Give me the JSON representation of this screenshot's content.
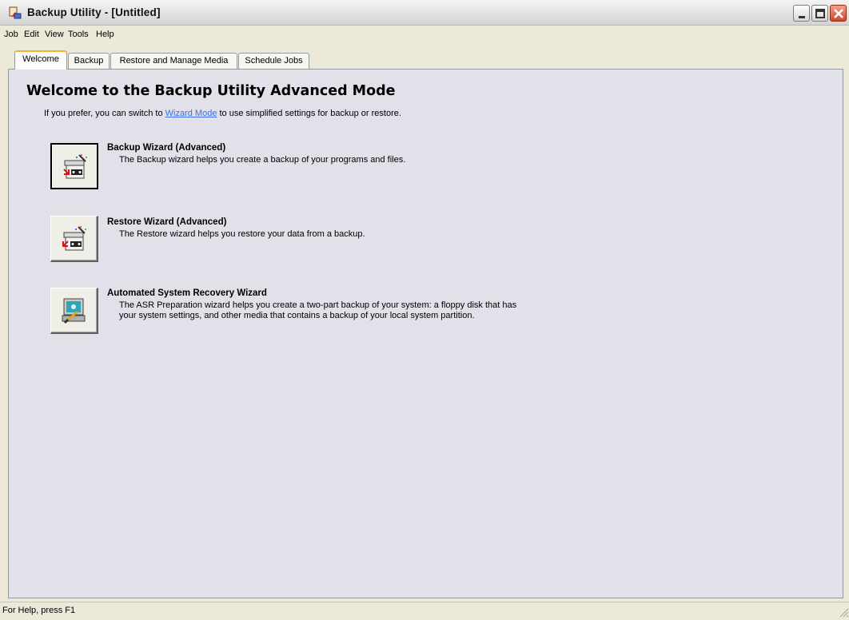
{
  "window": {
    "title": "Backup Utility - [Untitled]"
  },
  "menu": [
    "Job",
    "Edit",
    "View",
    "Tools",
    "Help"
  ],
  "tabs": [
    {
      "label": "Welcome",
      "active": true
    },
    {
      "label": "Backup",
      "active": false
    },
    {
      "label": "Restore and Manage Media",
      "active": false
    },
    {
      "label": "Schedule Jobs",
      "active": false
    }
  ],
  "welcome": {
    "heading": "Welcome to the Backup Utility Advanced Mode",
    "intro_before": "If you prefer, you can switch to ",
    "intro_link": "Wizard Mode",
    "intro_after": " to use simplified settings for backup or restore."
  },
  "wizards": [
    {
      "title": "Backup Wizard (Advanced)",
      "description": "The Backup wizard helps you create a backup of your programs and files.",
      "icon": "backup-wizard-icon"
    },
    {
      "title": "Restore Wizard (Advanced)",
      "description": "The Restore wizard helps you restore your data from a backup.",
      "icon": "restore-wizard-icon"
    },
    {
      "title": "Automated System Recovery Wizard",
      "description_line1": "The ASR Preparation wizard helps you create a two-part backup of your system: a floppy disk that has",
      "description_line2": "your system settings, and other media that contains a backup of your local system partition.",
      "icon": "asr-wizard-icon"
    }
  ],
  "status": {
    "text": "For Help, press F1"
  },
  "colors": {
    "link": "#3b6ee0",
    "active_tab_accent": "#f8b136",
    "panel": "#e2e0e8"
  }
}
